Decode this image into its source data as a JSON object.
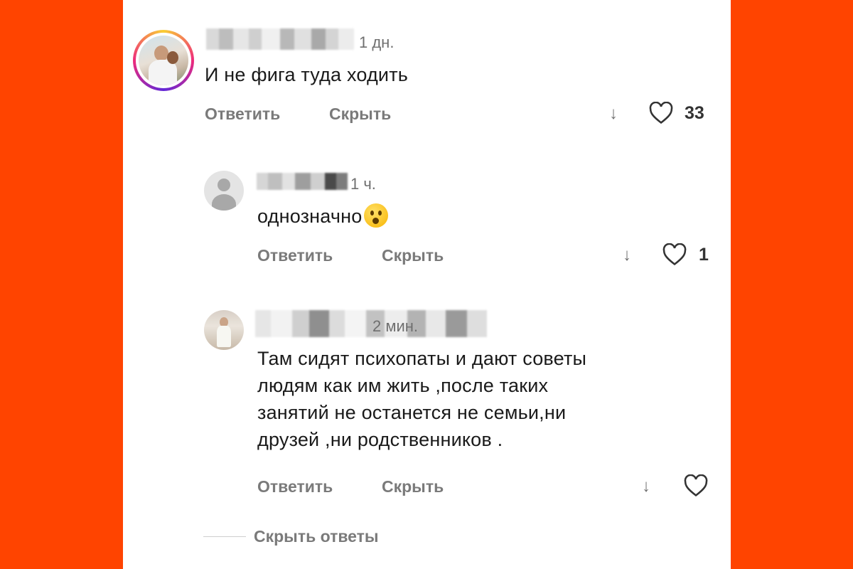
{
  "comments": [
    {
      "time": "1 дн.",
      "text": "И не фига туда ходить",
      "reply_label": "Ответить",
      "hide_label": "Скрыть",
      "likes": "33"
    },
    {
      "time": "1 ч.",
      "text": "однозначно",
      "reply_label": "Ответить",
      "hide_label": "Скрыть",
      "likes": "1"
    },
    {
      "time": "2 мин.",
      "text_lines": [
        "Там сидят психопаты и дают советы",
        "людям как им жить ,после таких",
        "занятий не останется не семьи,ни",
        "друзей ,ни родственников ."
      ],
      "reply_label": "Ответить",
      "hide_label": "Скрыть",
      "likes": ""
    }
  ],
  "hide_replies_label": "Скрыть ответы",
  "colors": {
    "background": "#ff4400",
    "panel": "#ffffff",
    "action_text": "#7a7a7a"
  },
  "icons": [
    "down-arrow-icon",
    "heart-icon",
    "astonished-emoji-icon",
    "default-avatar-icon"
  ]
}
